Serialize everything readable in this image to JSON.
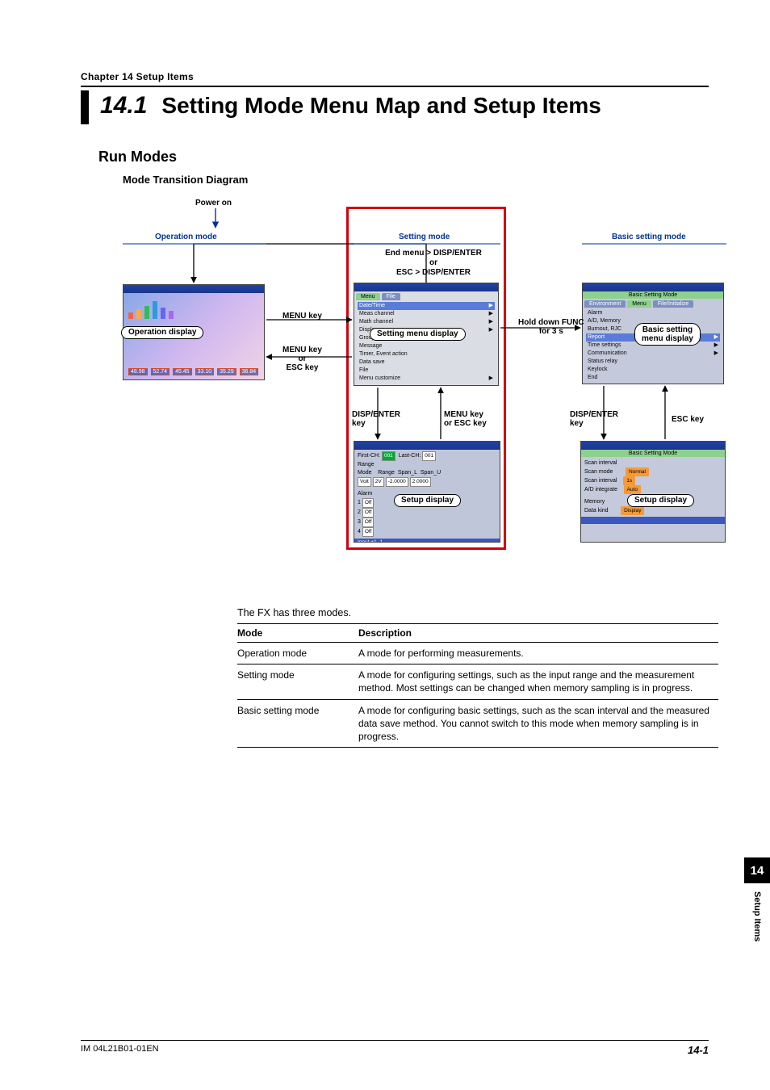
{
  "chapter_line": "Chapter 14    Setup Items",
  "heading": {
    "num": "14.1",
    "text": "Setting Mode Menu Map and Setup Items"
  },
  "h2": "Run Modes",
  "h3": "Mode Transition Diagram",
  "diagram": {
    "power_on": "Power on",
    "col_op": "Operation mode",
    "col_set": "Setting mode",
    "col_basic": "Basic setting mode",
    "path_top": "End menu > DISP/ENTER\nor\nESC > DISP/ENTER",
    "menu_key": "MENU key",
    "menu_or_esc": "MENU key\nor\nESC key",
    "hold_func": "Hold down FUNC\nfor 3 s",
    "disp_enter_key": "DISP/ENTER\nkey",
    "menu_or_esc_key": "MENU key\nor ESC key",
    "esc_key": "ESC key",
    "pill_op": "Operation display",
    "pill_setmenu": "Setting menu display",
    "pill_basicmenu": "Basic setting\nmenu display",
    "pill_setup": "Setup display",
    "pill_setup2": "Setup display",
    "menu_items": [
      "Date/Time",
      "Meas channel",
      "Math channel",
      "Display",
      "Group set, Trip line",
      "Message",
      "Timer, Event action",
      "Data save",
      "File",
      "Menu customize"
    ],
    "menu_tabs": [
      "Menu",
      "File"
    ],
    "bs_title": "Basic Setting Mode",
    "bs_tabs": [
      "Environment",
      "Menu",
      "File/Initialize"
    ],
    "bs_items": [
      "Alarm",
      "A/D, Memory",
      "Burnout, RJC",
      "Report",
      "Time settings",
      "Communication",
      "Status relay",
      "Keylock",
      "End"
    ],
    "bs2_title": "Basic Setting Mode",
    "bs2_rows": [
      {
        "k": "Scan interval",
        "v": ""
      },
      {
        "k": "Scan mode",
        "v": "Normal"
      },
      {
        "k": "Scan interval",
        "v": "1s"
      },
      {
        "k": "A/D integrate",
        "v": "Auto"
      },
      {
        "k": "Memory",
        "v": ""
      },
      {
        "k": "Data kind",
        "v": "Display"
      }
    ],
    "setup_rows": {
      "first": "First-CH:",
      "firstv": "001",
      "last": "Last-CH:",
      "lastv": "001",
      "range": "Range",
      "mode": "Mode",
      "r": "Range",
      "sl": "Span_L",
      "su": "Span_U",
      "modev": "Volt",
      "rv": "2V",
      "slv": "-2.0000",
      "suv": "2.0000",
      "alarm": "Alarm",
      "offs": [
        "Off",
        "Off",
        "Off",
        "Off"
      ],
      "foot": "Input    +1    -1"
    }
  },
  "intro": "The FX has three modes.",
  "table": {
    "head_mode": "Mode",
    "head_desc": "Description",
    "rows": [
      {
        "mode": "Operation mode",
        "desc": "A mode for performing measurements."
      },
      {
        "mode": "Setting mode",
        "desc": "A mode for configuring settings, such as the input range and the measurement method. Most settings can be changed when memory sampling is in progress."
      },
      {
        "mode": "Basic setting mode",
        "desc": "A mode for configuring basic settings, such as the scan interval and the measured data save method. You cannot switch to this mode when memory sampling is in progress."
      }
    ]
  },
  "side_tab": "14",
  "side_label": "Setup Items",
  "footer_left": "IM 04L21B01-01EN",
  "footer_right": "14-1"
}
